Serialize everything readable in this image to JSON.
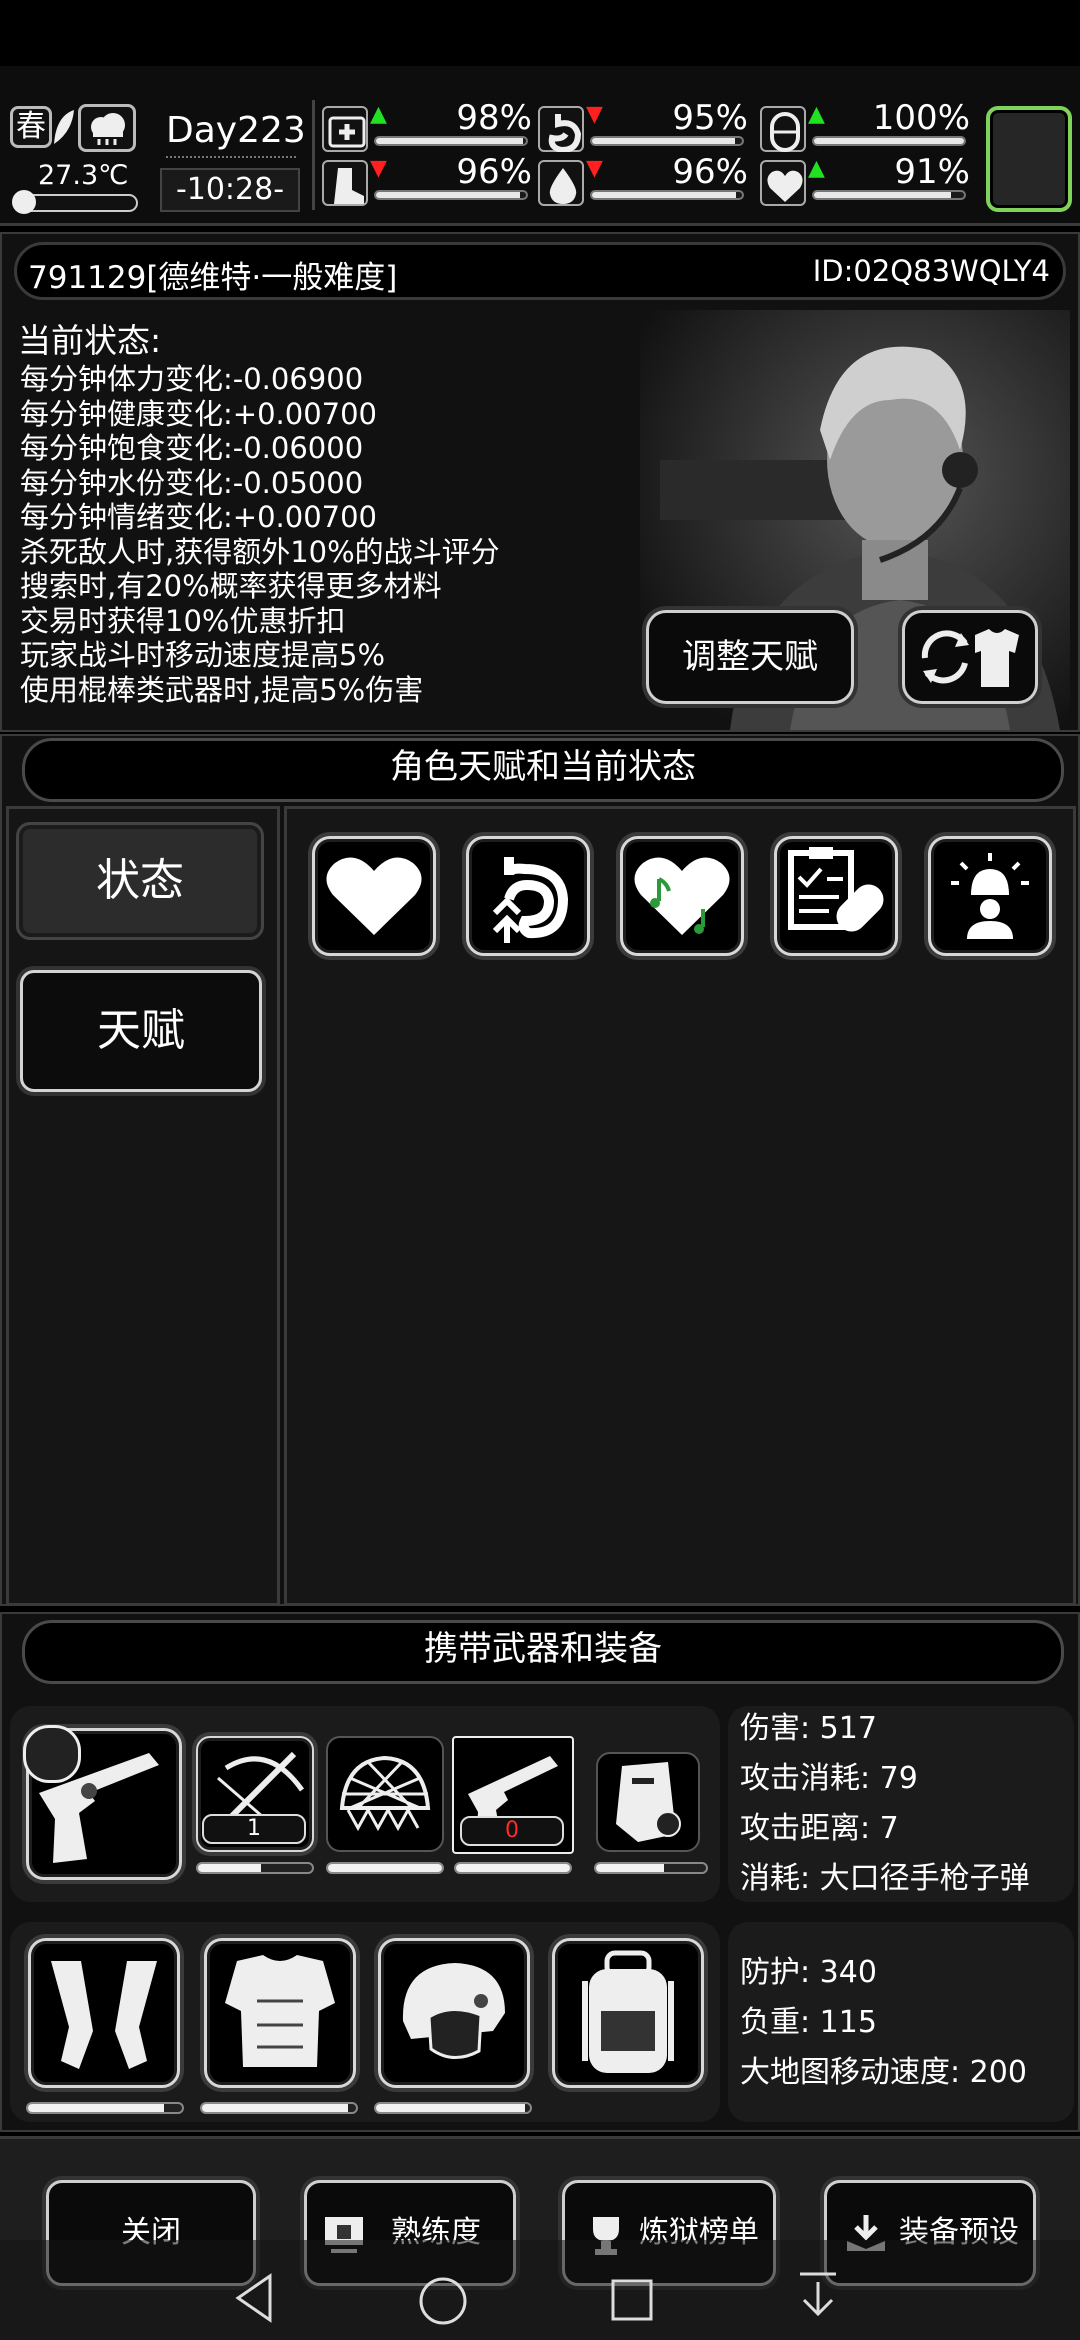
{
  "season": {
    "label": "春",
    "temperature": "27.3℃"
  },
  "day": {
    "label": "Day223",
    "time": "-10:28-"
  },
  "vitals": [
    {
      "name": "health",
      "icon": "medkit-icon",
      "trend": "up",
      "value": "98%",
      "fill": 0.98
    },
    {
      "name": "hunger",
      "icon": "stomach-icon",
      "trend": "down",
      "value": "95%",
      "fill": 0.95
    },
    {
      "name": "mood",
      "icon": "capsule-icon",
      "trend": "up",
      "value": "100%",
      "fill": 1.0
    },
    {
      "name": "stamina",
      "icon": "boot-icon",
      "trend": "down",
      "value": "96%",
      "fill": 0.96
    },
    {
      "name": "water",
      "icon": "water-drop-icon",
      "trend": "down",
      "value": "96%",
      "fill": 0.96
    },
    {
      "name": "emotion",
      "icon": "heart-hand-icon",
      "trend": "up",
      "value": "91%",
      "fill": 0.91
    }
  ],
  "profile": {
    "name": "791129[德维特·一般难度]",
    "id": "ID:02Q83WQLY4"
  },
  "status": {
    "heading": "当前状态:",
    "lines": [
      "每分钟体力变化:-0.06900",
      "每分钟健康变化:+0.00700",
      "每分钟饱食变化:-0.06000",
      "每分钟水份变化:-0.05000",
      "每分钟情绪变化:+0.00700",
      "杀死敌人时,获得额外10%的战斗评分",
      "搜索时,有20%概率获得更多材料",
      "交易时获得10%优惠折扣",
      "玩家战斗时移动速度提高5%",
      "使用棍棒类武器时,提高5%伤害"
    ],
    "adjust_button": "调整天赋"
  },
  "talent_section": {
    "title": "角色天赋和当前状态",
    "tabs": [
      "状态",
      "天赋"
    ],
    "active_tab": "状态",
    "icons": [
      "heart-icon",
      "stomach-arrows-icon",
      "music-heart-icon",
      "clipboard-bandage-icon",
      "alarm-person-icon"
    ]
  },
  "equipment_section": {
    "title": "携带武器和装备",
    "weapon_slots": [
      {
        "icon": "revolver-icon",
        "count": "",
        "durability": null
      },
      {
        "icon": "crossbow-icon",
        "count": "1",
        "durability": 0.55
      },
      {
        "icon": "helmet-net-icon",
        "count": "",
        "durability": 1.0
      },
      {
        "icon": "revolver-icon",
        "count": "0",
        "durability": 1.0
      },
      {
        "icon": "riot-shield-icon",
        "count": "",
        "durability": 0.62
      }
    ],
    "weapon_stats": {
      "damage": "伤害: 517",
      "attack_cost": "攻击消耗: 79",
      "attack_range": "攻击距离: 7",
      "consume": "消耗: 大口径手枪子弹"
    },
    "armor_slots": [
      {
        "icon": "gauntlets-icon",
        "durability": 0.88
      },
      {
        "icon": "body-armor-icon",
        "durability": 0.95
      },
      {
        "icon": "tactical-helmet-icon",
        "durability": 0.97
      },
      {
        "icon": "backpack-icon",
        "durability": null
      }
    ],
    "armor_stats": {
      "protection": "防护: 340",
      "load": "负重: 115",
      "map_speed": "大地图移动速度: 200"
    }
  },
  "bottom_buttons": {
    "close": "关闭",
    "proficiency": "熟练度",
    "leaderboard": "炼狱榜单",
    "preset": "装备预设"
  },
  "colors": {
    "up_arrow": "#22e022",
    "down_arrow": "#ff2020",
    "accent_green": "#7fd25a",
    "count_red": "#ff2a2a"
  }
}
